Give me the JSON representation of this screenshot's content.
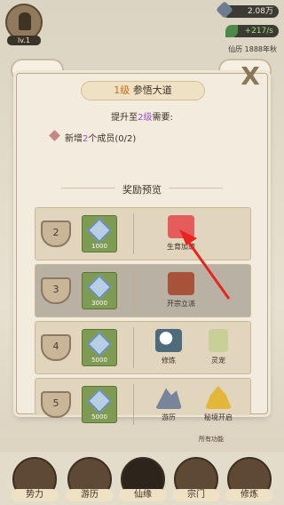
{
  "hud": {
    "level": "lv.1",
    "resource_top": "2.08万",
    "resource_green": "+217/s",
    "calendar": "仙历 1888年秋"
  },
  "dialog": {
    "level_tag": "1级",
    "title": "参悟大道",
    "upgrade_prefix": "提升至",
    "upgrade_level": "2级",
    "upgrade_suffix": "需要:",
    "requirement_prefix": "新增",
    "requirement_count": "2",
    "requirement_suffix": "个成员(0/2)",
    "section_title": "奖励预览",
    "close_label": "X"
  },
  "rewards": [
    {
      "level": "2",
      "crystal_qty": "1000",
      "items": [
        {
          "label": "生育加速",
          "icon": "heart-icon"
        }
      ],
      "dim": false
    },
    {
      "level": "3",
      "crystal_qty": "3000",
      "items": [
        {
          "label": "开宗立派",
          "icon": "palace-icon"
        }
      ],
      "dim": true
    },
    {
      "level": "4",
      "crystal_qty": "5000",
      "items": [
        {
          "label": "修炼",
          "icon": "yinyang-icon"
        },
        {
          "label": "灵宠",
          "icon": "egg-icon"
        }
      ],
      "dim": false
    },
    {
      "level": "5",
      "crystal_qty": "5000",
      "items": [
        {
          "label": "游历",
          "icon": "mountain-icon"
        },
        {
          "label": "秘境开启",
          "icon": "pagoda-icon"
        }
      ],
      "dim": false
    }
  ],
  "footer_note": "所有功能",
  "nav": [
    {
      "label": "势力"
    },
    {
      "label": "游历"
    },
    {
      "label": "仙缘"
    },
    {
      "label": "宗门"
    },
    {
      "label": "修炼"
    }
  ]
}
